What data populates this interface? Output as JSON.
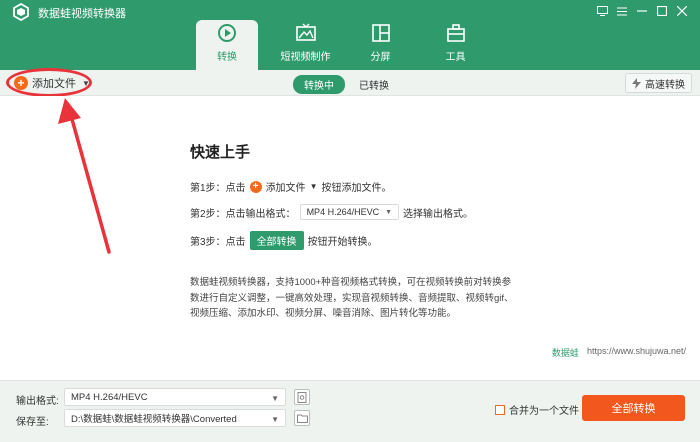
{
  "app": {
    "title": "数据蛙视频转换器"
  },
  "tabs": [
    {
      "label": "转换",
      "icon": "convert-icon",
      "active": true
    },
    {
      "label": "短视频制作",
      "icon": "short-video-icon",
      "active": false
    },
    {
      "label": "分屏",
      "icon": "split-screen-icon",
      "active": false
    },
    {
      "label": "工具",
      "icon": "toolbox-icon",
      "active": false
    }
  ],
  "toolbar": {
    "add_file": "添加文件",
    "seg_converting": "转换中",
    "seg_converted": "已转换",
    "fast_convert": "高速转换"
  },
  "guide": {
    "title": "快速上手",
    "step1_prefix": "第1步：点击",
    "step1_button": "添加文件",
    "step1_suffix": "按钮添加文件。",
    "step2_prefix": "第2步：点击输出格式：",
    "step2_format": "MP4 H.264/HEVC",
    "step2_suffix": "选择输出格式。",
    "step3_prefix": "第3步：点击",
    "step3_button": "全部转换",
    "step3_suffix": "按钮开始转换。",
    "description": "数据蛙视频转换器，支持1000+种音视频格式转换，可在视频转换前对转换参数进行自定义调整，一键高效处理，实现音视频转换、音频提取、视频转gif、视频压缩、添加水印、视频分屏、噪音消除、图片转化等功能。"
  },
  "brand": {
    "name": "数据蛙",
    "url": "https://www.shujuwa.net/"
  },
  "bottom": {
    "output_format_label": "输出格式:",
    "output_format_value": "MP4 H.264/HEVC",
    "save_to_label": "保存至:",
    "save_to_value": "D:\\数据蛙\\数据蛙视频转换器\\Converted",
    "merge_label": "合并为一个文件",
    "convert_all": "全部转换"
  },
  "colors": {
    "primary": "#2f9b6d",
    "accent": "#f2571d",
    "annotation": "#e8333b"
  }
}
